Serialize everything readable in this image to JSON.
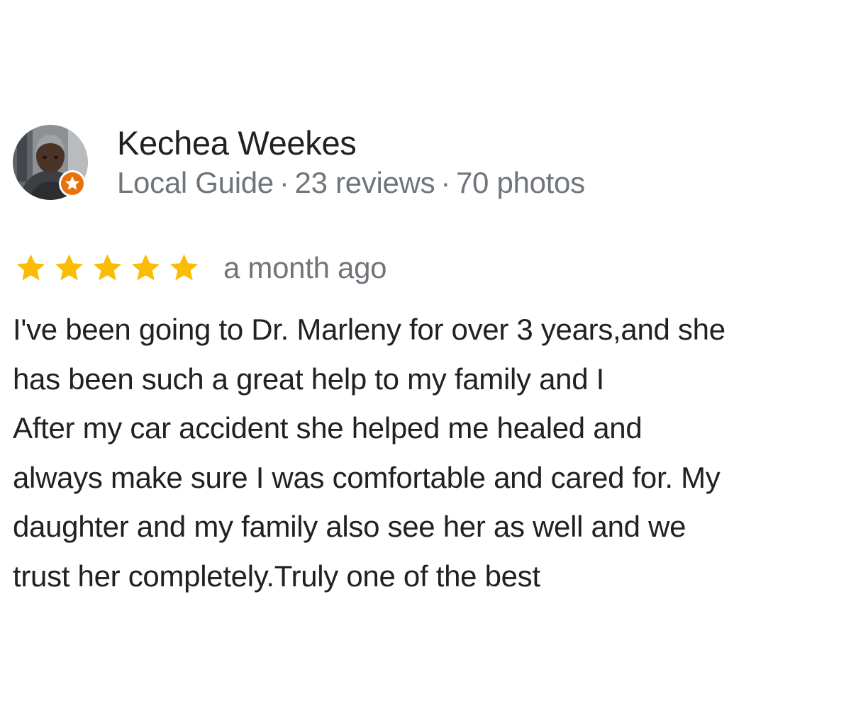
{
  "review": {
    "author": {
      "name": "Kechea Weekes",
      "level": "Local Guide",
      "separator": "·",
      "reviews_count": "23 reviews",
      "photos_count": "70 photos",
      "avatar_icon": "profile-photo",
      "badge_icon": "local-guide-star-badge"
    },
    "rating": {
      "stars": 5,
      "max": 5,
      "star_color": "#fbbc04",
      "star_icon": "star-icon"
    },
    "time": "a month ago",
    "text_lines": [
      "I've been going to Dr. Marleny for over 3 years,and she",
      "has been such a great help to my family and I",
      "After my car accident she helped me healed and",
      "always make sure I was comfortable and cared for. My",
      "daughter and my family also see her as well and we",
      "trust her completely.Truly one of the best"
    ]
  },
  "colors": {
    "text_primary": "#202124",
    "text_secondary": "#70757a",
    "badge_orange": "#e8710a"
  }
}
